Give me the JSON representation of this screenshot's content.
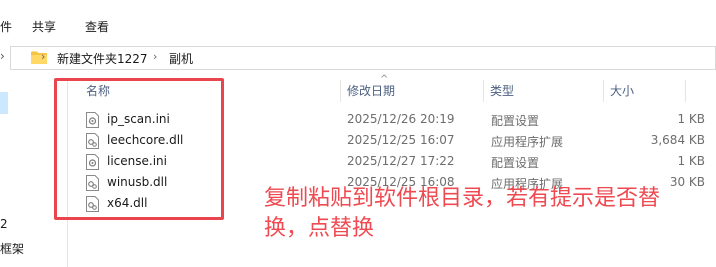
{
  "window": {
    "title_fragment": "件",
    "title": "副机"
  },
  "ribbon": {
    "tabs": [
      {
        "label": "件"
      },
      {
        "label": "共享"
      },
      {
        "label": "查看"
      }
    ]
  },
  "address_bar": {
    "crumbs": [
      {
        "label": "新建文件夹1227"
      },
      {
        "label": "副机"
      }
    ]
  },
  "nav_pane": {
    "items": [
      {
        "label": "2"
      },
      {
        "label": "框架"
      }
    ]
  },
  "file_list": {
    "columns": {
      "name": "名称",
      "modified": "修改日期",
      "type": "类型",
      "size": "大小"
    },
    "rows": [
      {
        "name": "ip_scan.ini",
        "modified": "2025/12/26 20:19",
        "type": "配置设置",
        "size": "1 KB",
        "icon": "ini-file-icon"
      },
      {
        "name": "leechcore.dll",
        "modified": "2025/12/25 16:07",
        "type": "应用程序扩展",
        "size": "3,684 KB",
        "icon": "dll-file-icon"
      },
      {
        "name": "license.ini",
        "modified": "2025/12/27 17:22",
        "type": "配置设置",
        "size": "1 KB",
        "icon": "ini-file-icon"
      },
      {
        "name": "winusb.dll",
        "modified": "2025/12/25 16:08",
        "type": "应用程序扩展",
        "size": "30 KB",
        "icon": "dll-file-icon"
      },
      {
        "name": "x64.dll",
        "modified": "",
        "type": "",
        "size": "",
        "icon": "dll-file-icon"
      }
    ]
  },
  "annotation": {
    "line1": "复制粘贴到软件根目录，若有提示是否替",
    "line2": "换，点替换",
    "color": "#ef4a51"
  },
  "highlight_color": "#e8454e"
}
